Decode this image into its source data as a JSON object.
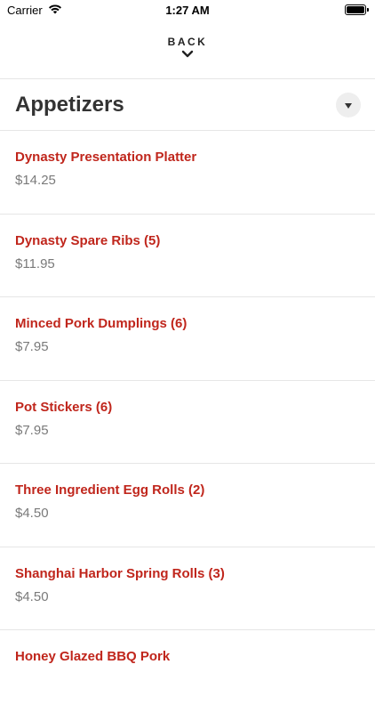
{
  "status_bar": {
    "carrier": "Carrier",
    "time": "1:27 AM",
    "battery_level": 1.0
  },
  "nav": {
    "back_label": "BACK"
  },
  "section": {
    "title": "Appetizers"
  },
  "menu_items": [
    {
      "name": "Dynasty Presentation Platter",
      "price": "$14.25"
    },
    {
      "name": "Dynasty Spare Ribs (5)",
      "price": "$11.95"
    },
    {
      "name": "Minced Pork Dumplings (6)",
      "price": "$7.95"
    },
    {
      "name": "Pot Stickers (6)",
      "price": "$7.95"
    },
    {
      "name": "Three Ingredient Egg Rolls (2)",
      "price": "$4.50"
    },
    {
      "name": "Shanghai Harbor Spring Rolls (3)",
      "price": "$4.50"
    },
    {
      "name": "Honey Glazed BBQ Pork",
      "price": ""
    }
  ],
  "colors": {
    "accent": "#c0261c",
    "price_text": "#7a7a7a",
    "divider": "#e6e6e6"
  },
  "icons": {
    "wifi": "wifi-icon",
    "battery": "battery-icon",
    "back_chevron": "chevron-down-icon",
    "dropdown": "caret-down-icon"
  }
}
